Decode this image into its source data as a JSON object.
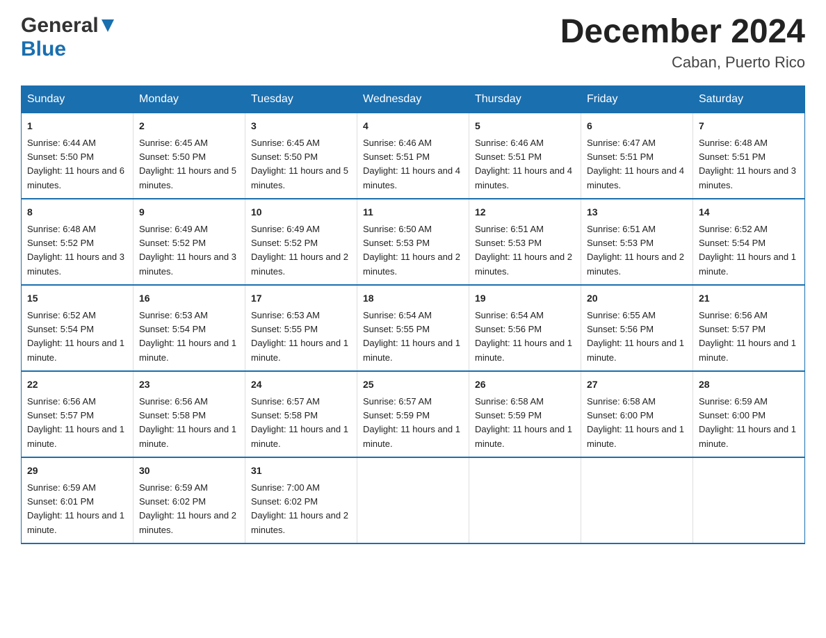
{
  "header": {
    "title": "December 2024",
    "subtitle": "Caban, Puerto Rico"
  },
  "logo": {
    "general": "General",
    "blue": "Blue"
  },
  "days_of_week": [
    "Sunday",
    "Monday",
    "Tuesday",
    "Wednesday",
    "Thursday",
    "Friday",
    "Saturday"
  ],
  "weeks": [
    [
      {
        "day": "1",
        "sunrise": "6:44 AM",
        "sunset": "5:50 PM",
        "daylight": "11 hours and 6 minutes."
      },
      {
        "day": "2",
        "sunrise": "6:45 AM",
        "sunset": "5:50 PM",
        "daylight": "11 hours and 5 minutes."
      },
      {
        "day": "3",
        "sunrise": "6:45 AM",
        "sunset": "5:50 PM",
        "daylight": "11 hours and 5 minutes."
      },
      {
        "day": "4",
        "sunrise": "6:46 AM",
        "sunset": "5:51 PM",
        "daylight": "11 hours and 4 minutes."
      },
      {
        "day": "5",
        "sunrise": "6:46 AM",
        "sunset": "5:51 PM",
        "daylight": "11 hours and 4 minutes."
      },
      {
        "day": "6",
        "sunrise": "6:47 AM",
        "sunset": "5:51 PM",
        "daylight": "11 hours and 4 minutes."
      },
      {
        "day": "7",
        "sunrise": "6:48 AM",
        "sunset": "5:51 PM",
        "daylight": "11 hours and 3 minutes."
      }
    ],
    [
      {
        "day": "8",
        "sunrise": "6:48 AM",
        "sunset": "5:52 PM",
        "daylight": "11 hours and 3 minutes."
      },
      {
        "day": "9",
        "sunrise": "6:49 AM",
        "sunset": "5:52 PM",
        "daylight": "11 hours and 3 minutes."
      },
      {
        "day": "10",
        "sunrise": "6:49 AM",
        "sunset": "5:52 PM",
        "daylight": "11 hours and 2 minutes."
      },
      {
        "day": "11",
        "sunrise": "6:50 AM",
        "sunset": "5:53 PM",
        "daylight": "11 hours and 2 minutes."
      },
      {
        "day": "12",
        "sunrise": "6:51 AM",
        "sunset": "5:53 PM",
        "daylight": "11 hours and 2 minutes."
      },
      {
        "day": "13",
        "sunrise": "6:51 AM",
        "sunset": "5:53 PM",
        "daylight": "11 hours and 2 minutes."
      },
      {
        "day": "14",
        "sunrise": "6:52 AM",
        "sunset": "5:54 PM",
        "daylight": "11 hours and 1 minute."
      }
    ],
    [
      {
        "day": "15",
        "sunrise": "6:52 AM",
        "sunset": "5:54 PM",
        "daylight": "11 hours and 1 minute."
      },
      {
        "day": "16",
        "sunrise": "6:53 AM",
        "sunset": "5:54 PM",
        "daylight": "11 hours and 1 minute."
      },
      {
        "day": "17",
        "sunrise": "6:53 AM",
        "sunset": "5:55 PM",
        "daylight": "11 hours and 1 minute."
      },
      {
        "day": "18",
        "sunrise": "6:54 AM",
        "sunset": "5:55 PM",
        "daylight": "11 hours and 1 minute."
      },
      {
        "day": "19",
        "sunrise": "6:54 AM",
        "sunset": "5:56 PM",
        "daylight": "11 hours and 1 minute."
      },
      {
        "day": "20",
        "sunrise": "6:55 AM",
        "sunset": "5:56 PM",
        "daylight": "11 hours and 1 minute."
      },
      {
        "day": "21",
        "sunrise": "6:56 AM",
        "sunset": "5:57 PM",
        "daylight": "11 hours and 1 minute."
      }
    ],
    [
      {
        "day": "22",
        "sunrise": "6:56 AM",
        "sunset": "5:57 PM",
        "daylight": "11 hours and 1 minute."
      },
      {
        "day": "23",
        "sunrise": "6:56 AM",
        "sunset": "5:58 PM",
        "daylight": "11 hours and 1 minute."
      },
      {
        "day": "24",
        "sunrise": "6:57 AM",
        "sunset": "5:58 PM",
        "daylight": "11 hours and 1 minute."
      },
      {
        "day": "25",
        "sunrise": "6:57 AM",
        "sunset": "5:59 PM",
        "daylight": "11 hours and 1 minute."
      },
      {
        "day": "26",
        "sunrise": "6:58 AM",
        "sunset": "5:59 PM",
        "daylight": "11 hours and 1 minute."
      },
      {
        "day": "27",
        "sunrise": "6:58 AM",
        "sunset": "6:00 PM",
        "daylight": "11 hours and 1 minute."
      },
      {
        "day": "28",
        "sunrise": "6:59 AM",
        "sunset": "6:00 PM",
        "daylight": "11 hours and 1 minute."
      }
    ],
    [
      {
        "day": "29",
        "sunrise": "6:59 AM",
        "sunset": "6:01 PM",
        "daylight": "11 hours and 1 minute."
      },
      {
        "day": "30",
        "sunrise": "6:59 AM",
        "sunset": "6:02 PM",
        "daylight": "11 hours and 2 minutes."
      },
      {
        "day": "31",
        "sunrise": "7:00 AM",
        "sunset": "6:02 PM",
        "daylight": "11 hours and 2 minutes."
      },
      null,
      null,
      null,
      null
    ]
  ],
  "labels": {
    "sunrise": "Sunrise:",
    "sunset": "Sunset:",
    "daylight": "Daylight:"
  }
}
